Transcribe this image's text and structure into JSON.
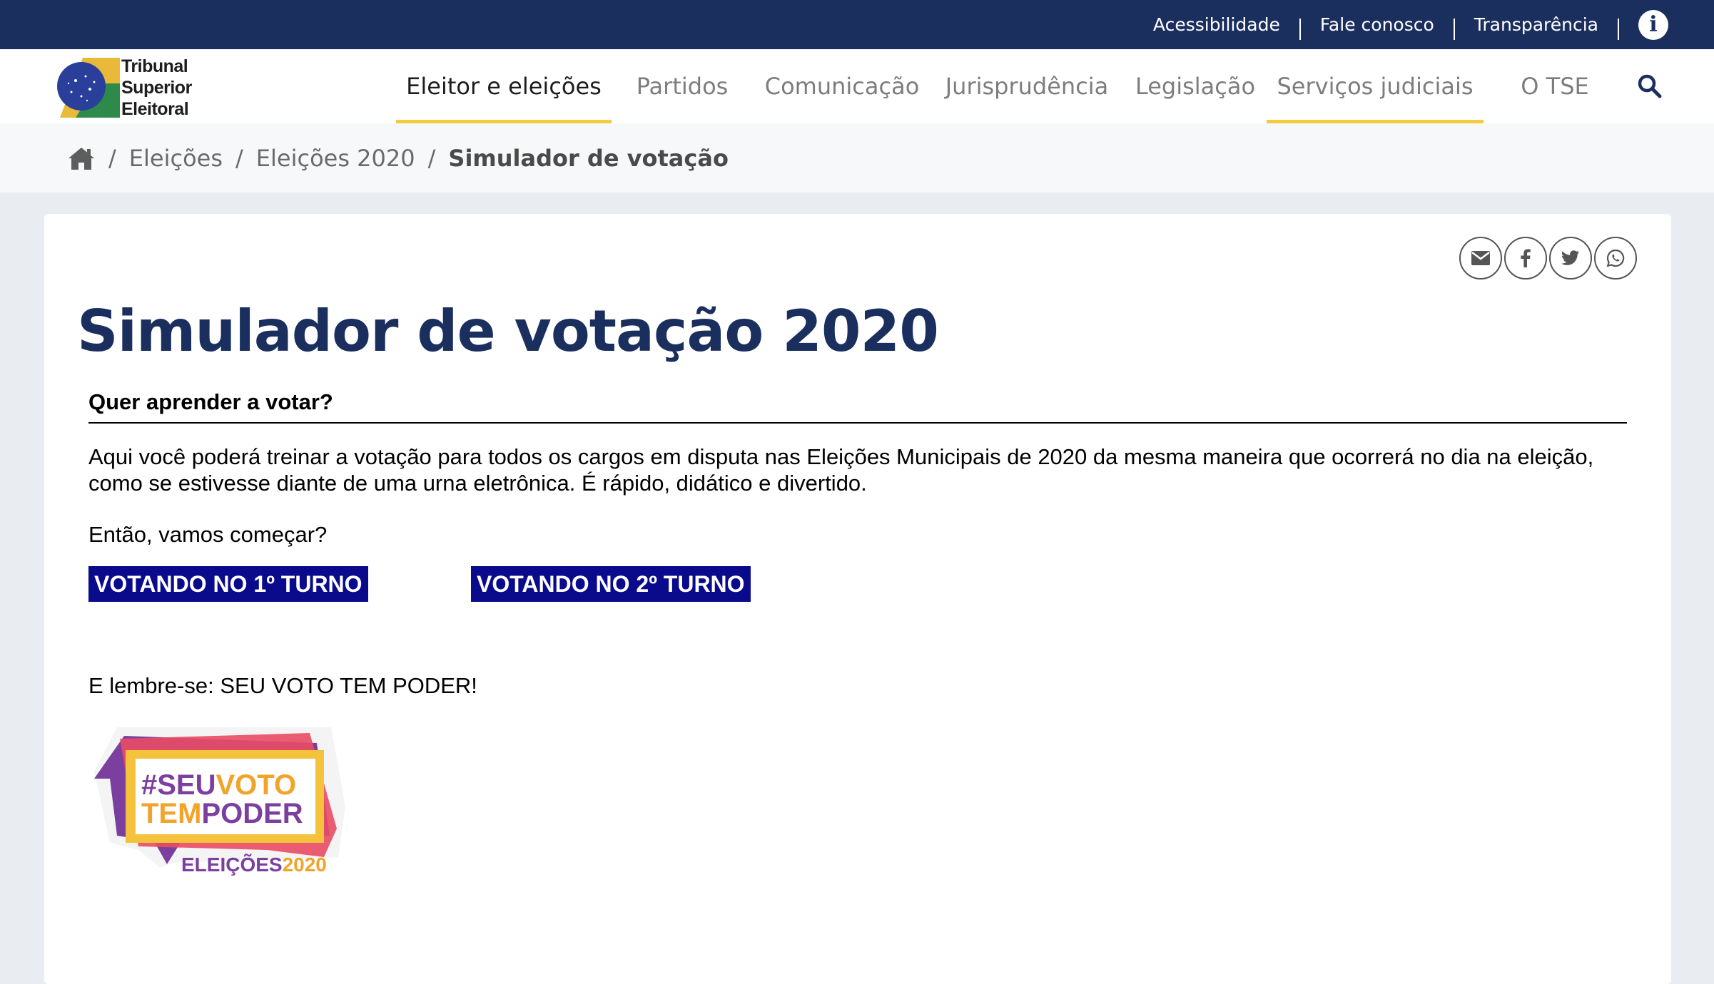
{
  "topbar": {
    "links": [
      "Acessibilidade",
      "Fale conosco",
      "Transparência"
    ],
    "info_icon": "info-icon"
  },
  "logo": {
    "line1": "Tribunal",
    "line2": "Superior",
    "line3": "Eleitoral"
  },
  "nav": {
    "items": [
      {
        "label": "Eleitor e eleições",
        "active": true
      },
      {
        "label": "Partidos",
        "active": false
      },
      {
        "label": "Comunicação",
        "active": false
      },
      {
        "label": "Jurisprudência",
        "active": false
      },
      {
        "label": "Legislação",
        "active": false
      },
      {
        "label": "Serviços judiciais",
        "active": false
      },
      {
        "label": "O TSE",
        "active": false
      }
    ],
    "search_icon": "search-icon"
  },
  "breadcrumb": {
    "items": [
      "Eleições",
      "Eleições 2020"
    ],
    "current": "Simulador de votação"
  },
  "share": [
    "email-icon",
    "facebook-icon",
    "twitter-icon",
    "whatsapp-icon"
  ],
  "content": {
    "title": "Simulador de votação 2020",
    "subhead": "Quer aprender a votar?",
    "intro": "Aqui você poderá treinar a votação para todos os cargos em disputa nas Eleições Municipais de 2020 da mesma maneira que ocorrerá no dia na eleição, como se estivesse diante de uma urna eletrônica. É rápido, didático e divertido.",
    "ask": "Então, vamos começar?",
    "button1": "VOTANDO NO 1º TURNO",
    "button2": "VOTANDO NO 2º TURNO",
    "remember": "E lembre-se: SEU VOTO TEM PODER!"
  },
  "badge": {
    "line1a": "#SEU",
    "line1b": "VOTO",
    "line2a": "TEM",
    "line2b": "PODER",
    "line3a": "ELEIÇÕES",
    "line3b": "2020"
  },
  "colors": {
    "topbar": "#1b2f5e",
    "title": "#1b2f5e",
    "accent_underline": "#f4ca3f",
    "vote_button": "#0a0a8c"
  }
}
